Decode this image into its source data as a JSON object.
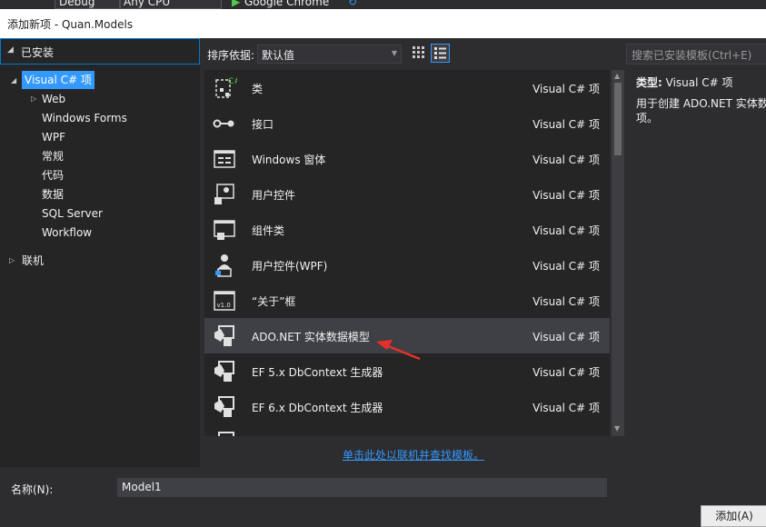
{
  "top_toolbar": {
    "config": "Debug",
    "platform": "Any CPU",
    "run_target": "Google Chrome"
  },
  "dialog": {
    "title": "添加新项 - Quan.Models"
  },
  "left_panel": {
    "installed_label": "已安装",
    "selected_node": "Visual C# 项",
    "children": [
      "Web",
      "Windows Forms",
      "WPF",
      "常规",
      "代码",
      "数据",
      "SQL Server",
      "Workflow"
    ],
    "online_label": "联机"
  },
  "toolbar": {
    "sort_label": "排序依据:",
    "sort_value": "默认值",
    "search_placeholder": "搜索已安装模板(Ctrl+E)"
  },
  "templates": [
    {
      "name": "类",
      "type": "Visual C# 项",
      "icon": "class-icon"
    },
    {
      "name": "接口",
      "type": "Visual C# 项",
      "icon": "interface-icon"
    },
    {
      "name": "Windows 窗体",
      "type": "Visual C# 项",
      "icon": "windows-form-icon"
    },
    {
      "name": "用户控件",
      "type": "Visual C# 项",
      "icon": "user-control-icon"
    },
    {
      "name": "组件类",
      "type": "Visual C# 项",
      "icon": "component-class-icon"
    },
    {
      "name": "用户控件(WPF)",
      "type": "Visual C# 项",
      "icon": "wpf-user-control-icon"
    },
    {
      "name": "“关于”框",
      "type": "Visual C# 项",
      "icon": "about-box-icon"
    },
    {
      "name": "ADO.NET 实体数据模型",
      "type": "Visual C# 项",
      "icon": "entity-model-icon",
      "selected": true
    },
    {
      "name": "EF 5.x DbContext 生成器",
      "type": "Visual C# 项",
      "icon": "ef-generator-icon"
    },
    {
      "name": "EF 6.x DbContext 生成器",
      "type": "Visual C# 项",
      "icon": "ef-generator-icon"
    }
  ],
  "details": {
    "type_label": "类型:",
    "type_value": "Visual C# 项",
    "description": "用于创建 ADO.NET 实体数\n项。"
  },
  "online_link": "单击此处以联机并查找模板。",
  "name_field": {
    "label": "名称(N):",
    "value": "Model1"
  },
  "buttons": {
    "add": "添加(A)"
  },
  "colors": {
    "background": "#2d2d30",
    "accent": "#3399ff",
    "selected_row": "#3f3f46",
    "annotation_arrow": "#e8302a"
  }
}
